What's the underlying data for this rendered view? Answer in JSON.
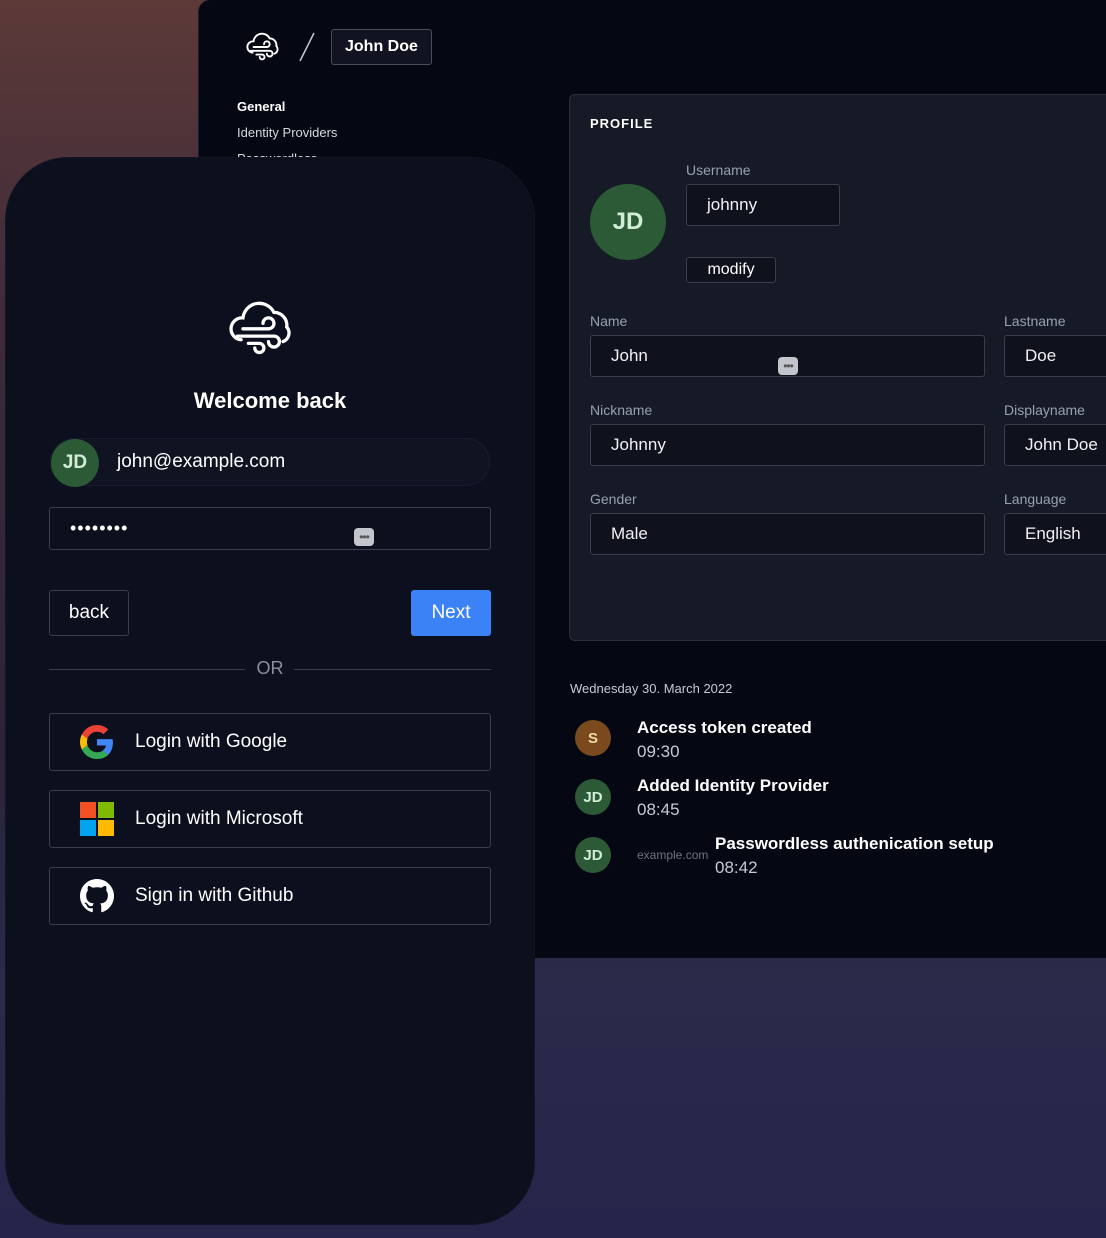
{
  "console": {
    "breadcrumb_org": "John Doe",
    "nav": {
      "general": "General",
      "identity_providers": "Identity Providers",
      "partial": "Passwordless"
    },
    "profile": {
      "heading": "PROFILE",
      "avatar_initials": "JD",
      "username_label": "Username",
      "username_value": "johnny",
      "modify_label": "modify",
      "name_label": "Name",
      "name_value": "John",
      "lastname_label": "Lastname",
      "lastname_value": "Doe",
      "nickname_label": "Nickname",
      "nickname_value": "Johnny",
      "displayname_label": "Displayname",
      "displayname_value": "John Doe",
      "gender_label": "Gender",
      "gender_value": "Male",
      "language_label": "Language",
      "language_value": "English"
    },
    "activity": {
      "date": "Wednesday 30. March 2022",
      "events": [
        {
          "initials": "S",
          "title": "Access token created",
          "time": "09:30"
        },
        {
          "initials": "JD",
          "title": "Added Identity Provider",
          "time": "08:45"
        },
        {
          "initials": "JD",
          "org": "example.com",
          "title": "Passwordless authenication setup",
          "time": "08:42"
        }
      ]
    }
  },
  "login": {
    "welcome": "Welcome back",
    "avatar_initials": "JD",
    "email": "john@example.com",
    "password_mask": "••••••••",
    "back_label": "back",
    "next_label": "Next",
    "or_label": "OR",
    "providers": [
      {
        "icon": "google-icon",
        "label": "Login with Google"
      },
      {
        "icon": "microsoft-icon",
        "label": "Login with Microsoft"
      },
      {
        "icon": "github-icon",
        "label": "Sign in with Github"
      }
    ]
  },
  "colors": {
    "primary_button": "#3b82f6",
    "avatar_green": "#2c5a37",
    "avatar_brown": "#7a4a1e"
  }
}
